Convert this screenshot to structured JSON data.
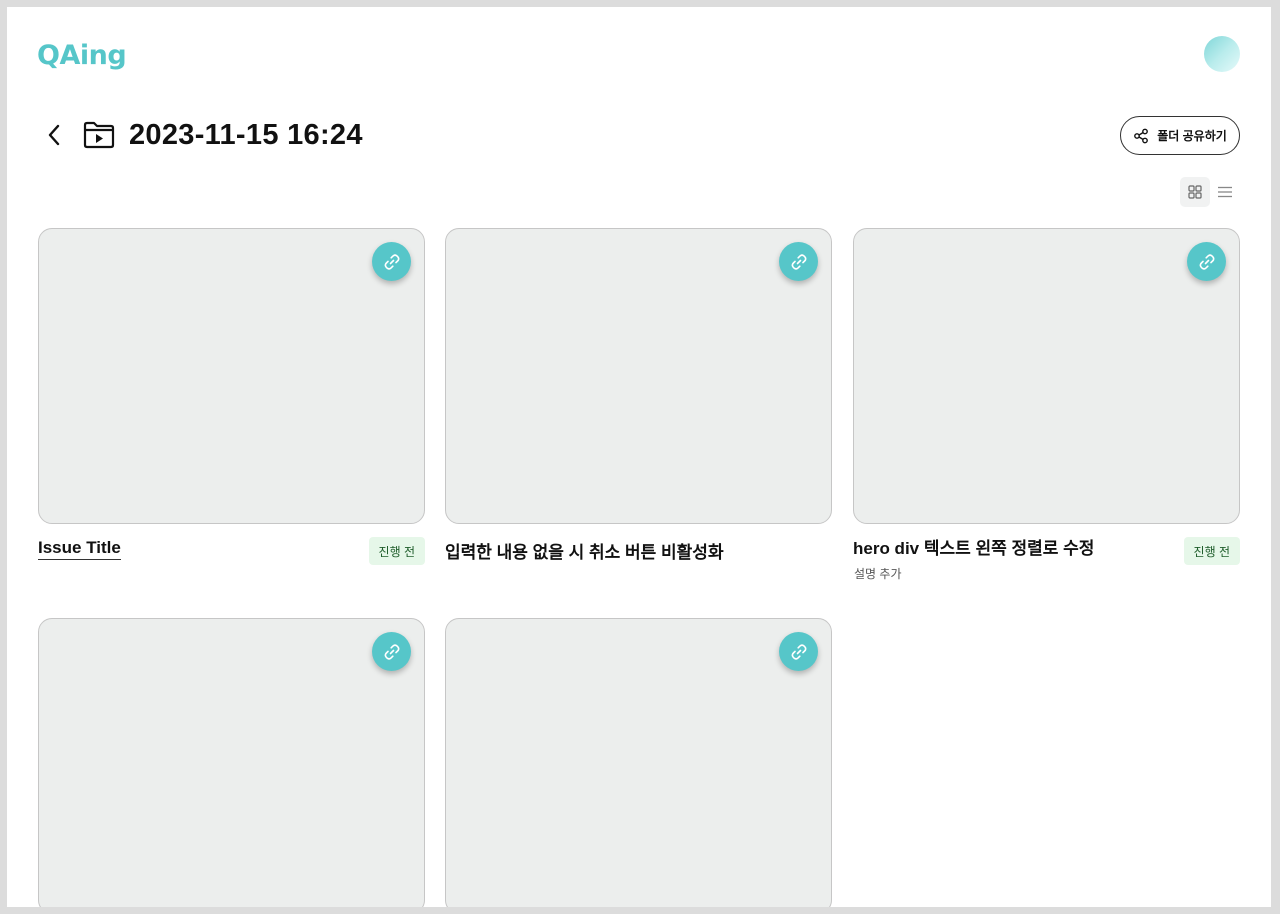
{
  "brand": {
    "logo_text": "QAing",
    "accent": "#56c6c9"
  },
  "header": {
    "avatar": "user-avatar"
  },
  "folder": {
    "title": "2023-11-15 16:24",
    "share_label": "폴더 공유하기"
  },
  "view": {
    "grid_icon": "grid-view-icon",
    "list_icon": "list-view-icon",
    "selected": "grid"
  },
  "cards": [
    {
      "title": "Issue Title",
      "status": "진행 전",
      "description": ""
    },
    {
      "title": "입력한 내용 없을 시 취소 버튼 비활성화",
      "status": "",
      "description": ""
    },
    {
      "title": "hero div 텍스트 왼쪽 정렬로 수정",
      "status": "진행 전",
      "description": "설명 추가"
    },
    {
      "title": "",
      "status": "",
      "description": ""
    },
    {
      "title": "",
      "status": "",
      "description": ""
    }
  ]
}
